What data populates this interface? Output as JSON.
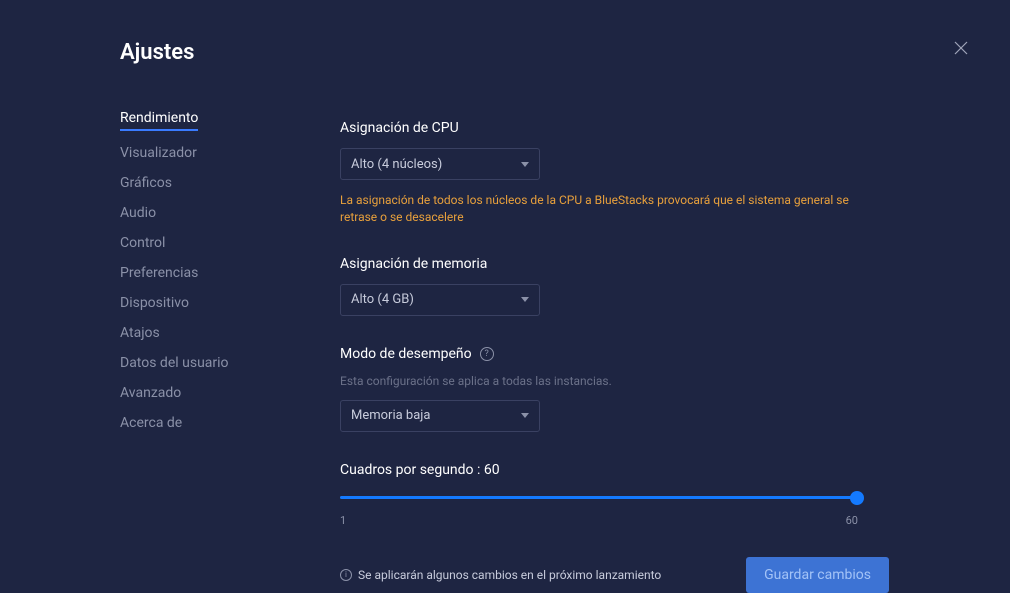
{
  "title": "Ajustes",
  "sidebar": {
    "items": [
      {
        "label": "Rendimiento",
        "active": true
      },
      {
        "label": "Visualizador",
        "active": false
      },
      {
        "label": "Gráficos",
        "active": false
      },
      {
        "label": "Audio",
        "active": false
      },
      {
        "label": "Control",
        "active": false
      },
      {
        "label": "Preferencias",
        "active": false
      },
      {
        "label": "Dispositivo",
        "active": false
      },
      {
        "label": "Atajos",
        "active": false
      },
      {
        "label": "Datos del usuario",
        "active": false
      },
      {
        "label": "Avanzado",
        "active": false
      },
      {
        "label": "Acerca de",
        "active": false
      }
    ]
  },
  "sections": {
    "cpu": {
      "label": "Asignación de CPU",
      "value": "Alto (4 núcleos)",
      "warning": "La asignación de todos los núcleos de la CPU a BlueStacks provocará que el sistema general se retrase o se desacelere"
    },
    "memory": {
      "label": "Asignación de memoria",
      "value": "Alto (4 GB)"
    },
    "performance": {
      "label": "Modo de desempeño",
      "sublabel": "Esta configuración se aplica a todas las instancias.",
      "value": "Memoria baja"
    },
    "fps": {
      "label": "Cuadros por segundo : 60",
      "min": "1",
      "max": "60"
    }
  },
  "footer": {
    "info": "Se aplicarán algunos cambios en el próximo lanzamiento",
    "save": "Guardar cambios"
  }
}
